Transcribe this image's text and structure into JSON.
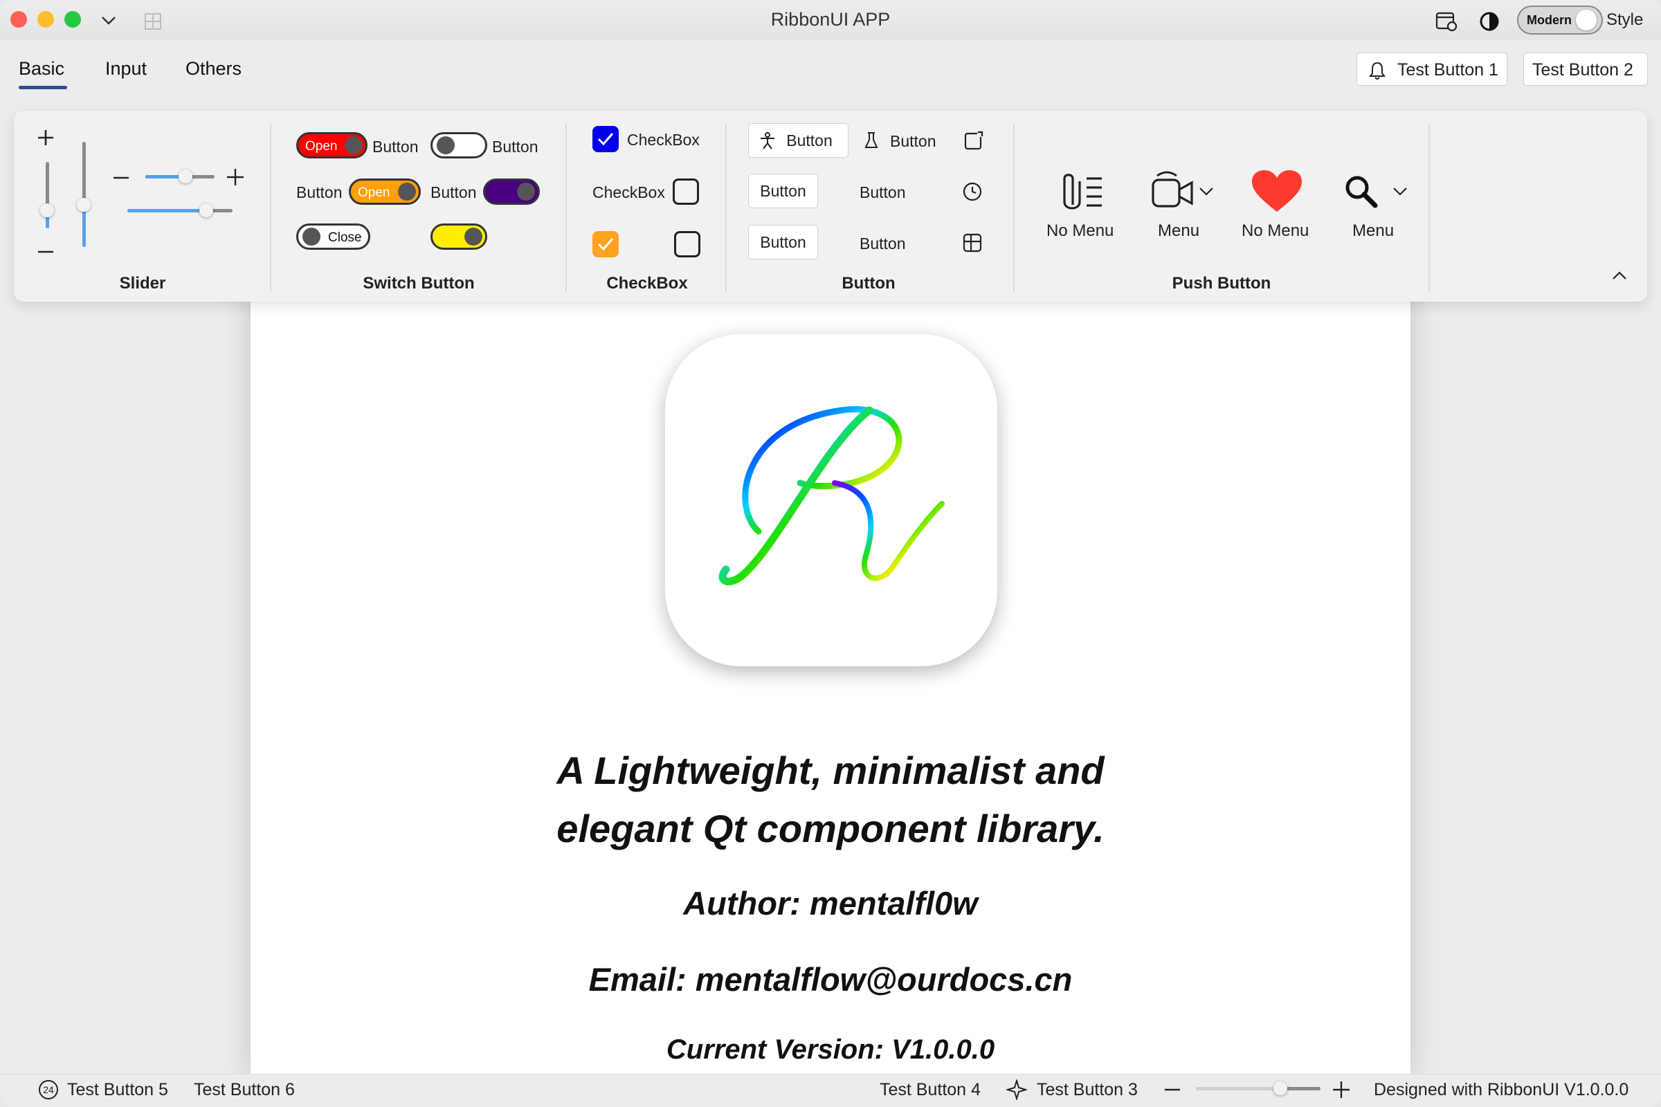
{
  "window": {
    "title": "RibbonUI APP"
  },
  "titlebar": {
    "style_toggle_label": "Modern",
    "style_label": "Style"
  },
  "tabs": [
    {
      "label": "Basic"
    },
    {
      "label": "Input"
    },
    {
      "label": "Others"
    }
  ],
  "top_buttons": {
    "test1": "Test Button 1",
    "test2": "Test Button 2"
  },
  "ribbon": {
    "slider": {
      "title": "Slider"
    },
    "switch": {
      "title": "Switch Button",
      "open": "Open",
      "close": "Close",
      "button": "Button"
    },
    "checkbox": {
      "title": "CheckBox",
      "label": "CheckBox"
    },
    "button": {
      "title": "Button",
      "label": "Button"
    },
    "push": {
      "title": "Push Button",
      "items": [
        {
          "label": "No Menu"
        },
        {
          "label": "Menu"
        },
        {
          "label": "No Menu"
        },
        {
          "label": "Menu"
        }
      ]
    }
  },
  "content": {
    "logo_letter": "R",
    "slogan_line1": "A Lightweight, minimalist and",
    "slogan_line2": "elegant Qt component library.",
    "author": "Author: mentalfl0w",
    "email": "Email: mentalflow@ourdocs.cn",
    "version": "Current Version: V1.0.0.0"
  },
  "statusbar": {
    "badge": "24",
    "test5": "Test Button 5",
    "test6": "Test Button 6",
    "test4": "Test Button 4",
    "test3": "Test Button 3",
    "designed": "Designed with RibbonUI V1.0.0.0"
  },
  "colors": {
    "accent": "#2d4c8e",
    "switch_red": "#ff0000",
    "switch_orange": "#ff9f0a",
    "switch_purple": "#4b0082",
    "switch_yellow": "#ffee00",
    "checkbox_blue": "#0000ee",
    "checkbox_orange": "#ffa21f",
    "heart": "#ff3b30"
  }
}
